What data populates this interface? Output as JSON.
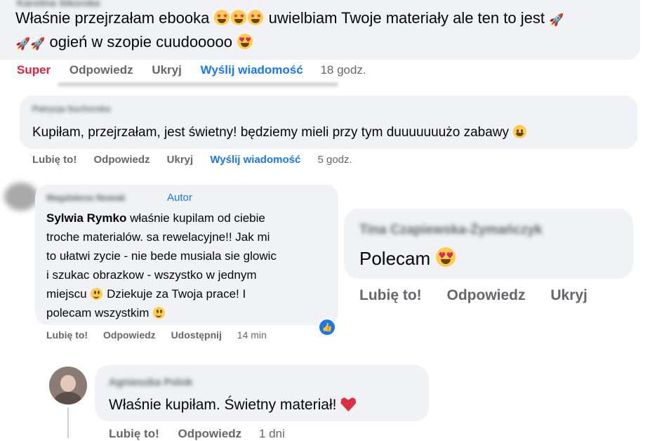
{
  "c1": {
    "name_blurred": "Karolina Sikorska",
    "text_part1": "Właśnie przejrzałam ebooka",
    "text_part2": "uwielbiam Twoje materiały ale ten to jest",
    "text_part3": "ogień w szopie cuudooooo",
    "actions": {
      "super": "Super",
      "reply": "Odpowiedz",
      "hide": "Ukryj",
      "send": "Wyślij wiadomość",
      "time": "18 godz."
    }
  },
  "c2": {
    "name": "Patrycja Suchorska",
    "text": "Kupiłam, przejrzałam, jest świetny! będziemy mieli przy tym duuuuuuużo zabawy",
    "actions": {
      "like": "Lubię to!",
      "reply": "Odpowiedz",
      "hide": "Ukryj",
      "send": "Wyślij wiadomość",
      "time": "5 godz."
    }
  },
  "c3": {
    "name": "Magdalena Nowak",
    "badge": "Autor",
    "mention": "Sylwia Rymko",
    "text_a": "właśnie kupilam od ciebie",
    "line2": "troche materialów. sa rewelacyjne!! Jak mi",
    "line3": "to ułatwi zycie - nie bede musiala sie glowic",
    "line4": "i szukac obrazkow - wszystko w jednym",
    "line5": "miejscu",
    "line5b": "Dziekuje za Twoja prace! I",
    "line6": "polecam wszystkim",
    "actions": {
      "like": "Lubię to!",
      "reply": "Odpowiedz",
      "share": "Udostępnij",
      "time": "14 min"
    }
  },
  "c4": {
    "name": "Tina Czapiewska-Żymańczyk",
    "text": "Polecam",
    "actions": {
      "like": "Lubię to!",
      "reply": "Odpowiedz",
      "hide": "Ukryj"
    }
  },
  "c5": {
    "name": "Agnieszka Polok",
    "text": "Właśnie kupiłam. Świetny materiał!",
    "actions": {
      "like": "Lubię to!",
      "reply": "Odpowiedz",
      "time": "1 dni"
    }
  },
  "colors": {
    "bubble": "#f0f2f5",
    "link": "#1877f2",
    "super": "#e41e3f",
    "muted": "#65676b"
  }
}
